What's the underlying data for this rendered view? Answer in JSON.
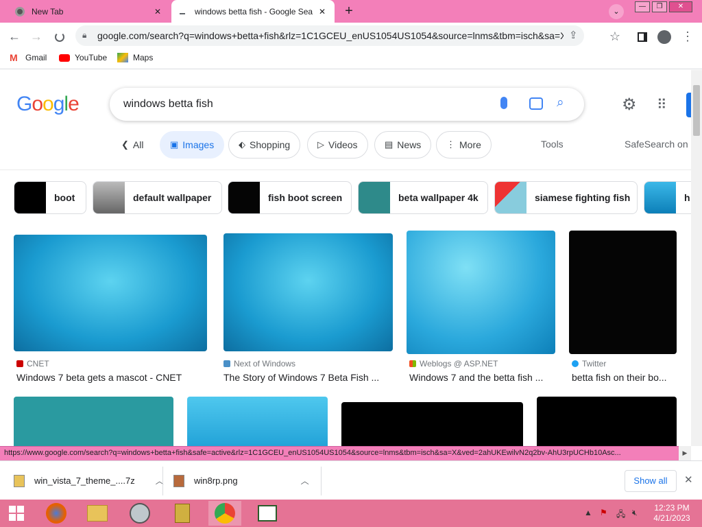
{
  "browser": {
    "tabs": [
      {
        "label": "New Tab"
      },
      {
        "label": "windows betta fish - Google Sear"
      }
    ],
    "url": "google.com/search?q=windows+betta+fish&rlz=1C1GCEU_enUS1054US1054&source=lnms&tbm=isch&sa=X&...",
    "bookmarks": [
      {
        "label": "Gmail"
      },
      {
        "label": "YouTube"
      },
      {
        "label": "Maps"
      }
    ]
  },
  "google": {
    "logo": "Google",
    "query": "windows betta fish",
    "nav": {
      "all": "All",
      "images": "Images",
      "shopping": "Shopping",
      "videos": "Videos",
      "news": "News",
      "more": "More",
      "tools": "Tools",
      "safesearch": "SafeSearch on"
    },
    "related": [
      "boot",
      "default wallpaper",
      "fish boot screen",
      "beta wallpaper 4k",
      "siamese fighting fish",
      "h"
    ],
    "results": [
      {
        "source": "CNET",
        "title": "Windows 7 beta gets a mascot - CNET"
      },
      {
        "source": "Next of Windows",
        "title": "The Story of Windows 7 Beta Fish ..."
      },
      {
        "source": "Weblogs @ ASP.NET",
        "title": "Windows 7 and the betta fish ..."
      },
      {
        "source": "Twitter",
        "title": "betta fish on their bo..."
      }
    ]
  },
  "statusbar": {
    "link": "https://www.google.com/search?q=windows+betta+fish&safe=active&rlz=1C1GCEU_enUS1054US1054&source=lnms&tbm=isch&sa=X&ved=2ahUKEwilvN2q2bv-AhU3rpUCHb10Asc..."
  },
  "downloads": {
    "items": [
      {
        "name": "win_vista_7_theme_....7z"
      },
      {
        "name": "win8rp.png"
      }
    ],
    "show_all": "Show all"
  },
  "taskbar": {
    "time": "12:23 PM",
    "date": "4/21/2023"
  },
  "colors": {
    "tabstrip": "#f37fb9",
    "taskbar": "#e57395",
    "google_blue": "#4285f4",
    "google_red": "#ea4335",
    "google_yellow": "#fbbc05",
    "google_green": "#34a853"
  }
}
